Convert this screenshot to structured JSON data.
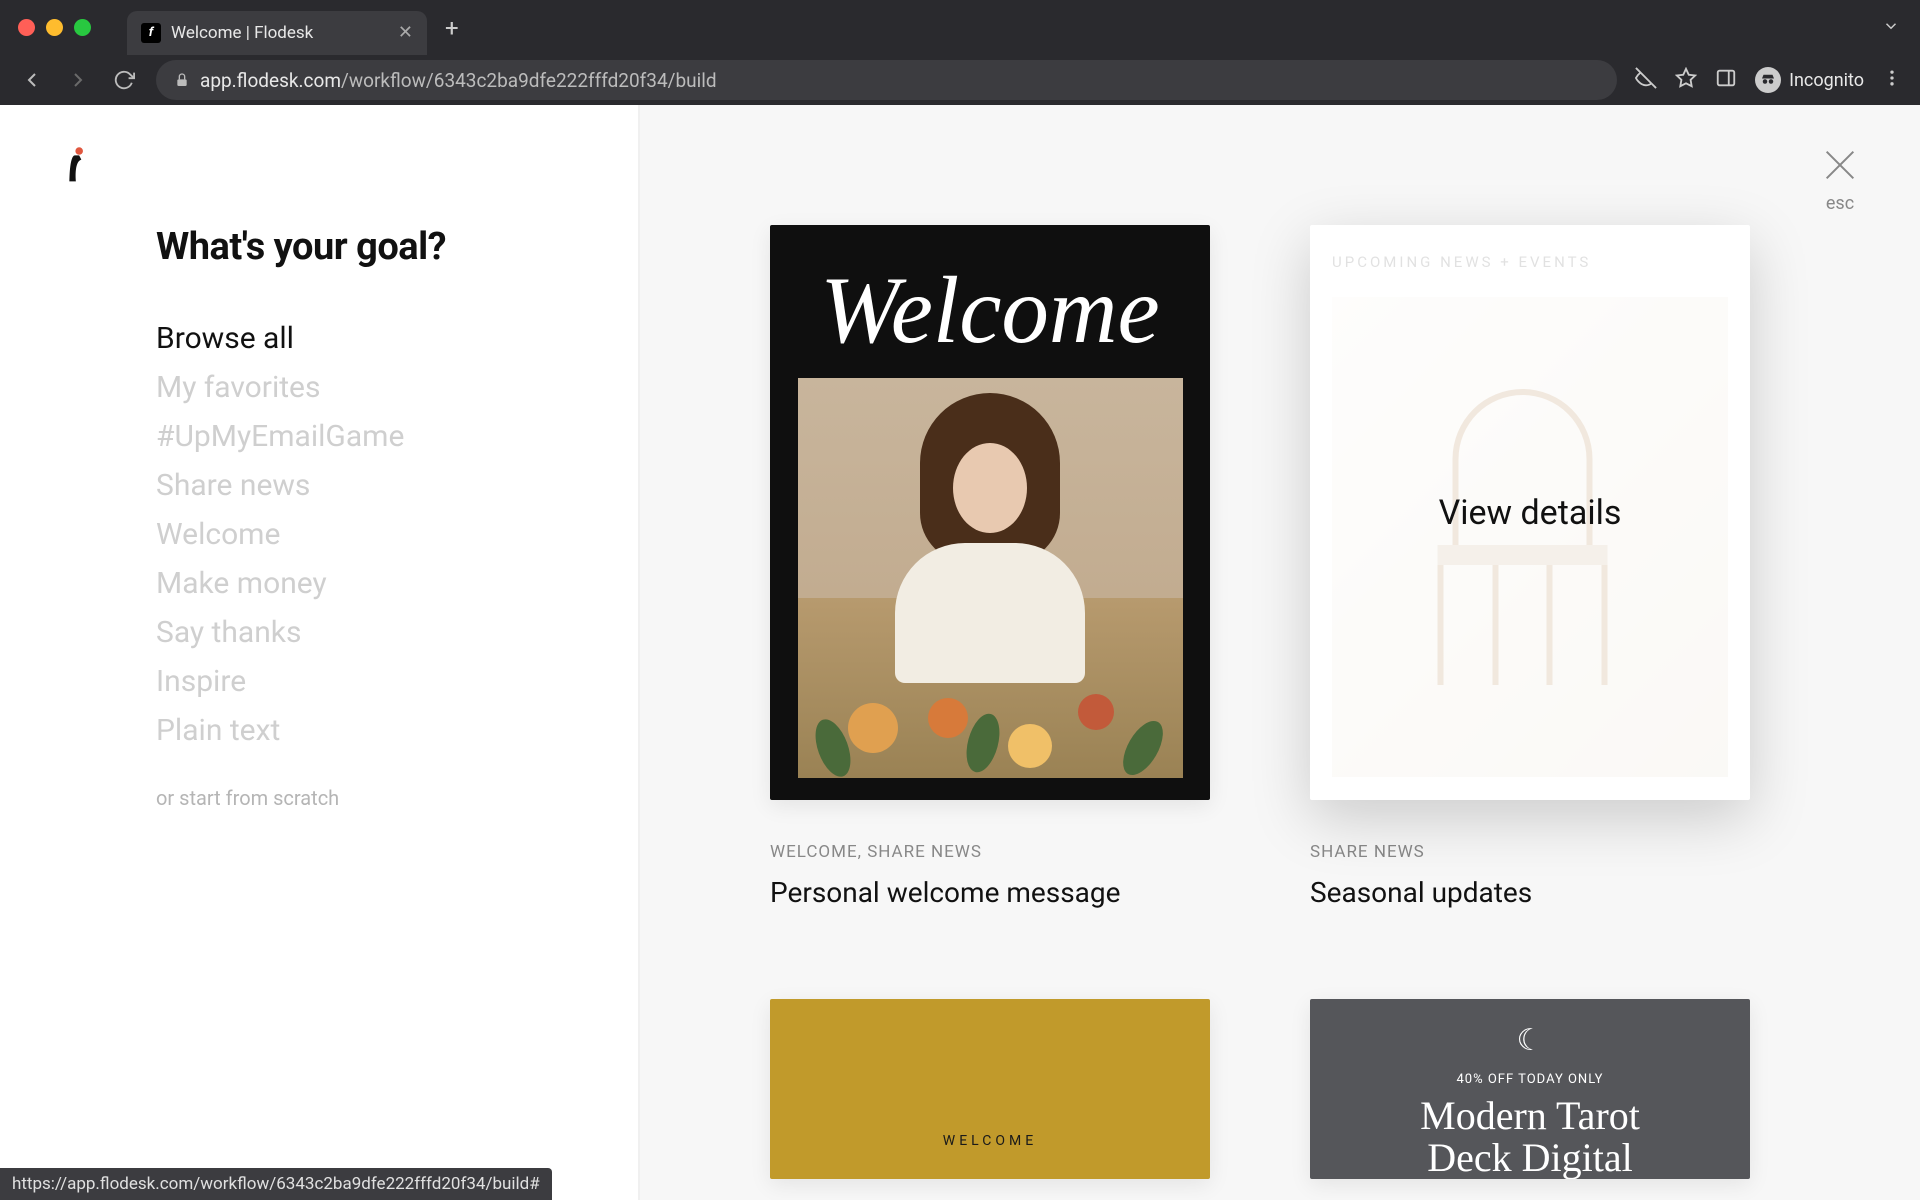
{
  "browser": {
    "tab_title": "Welcome | Flodesk",
    "url_host": "app.flodesk.com",
    "url_path": "/workflow/6343c2ba9dfe222fffd20f34/build",
    "incognito_label": "Incognito",
    "status_bar": "https://app.flodesk.com/workflow/6343c2ba9dfe222fffd20f34/build#"
  },
  "close": {
    "label": "esc"
  },
  "sidebar": {
    "title": "What's your goal?",
    "items": [
      "Browse all",
      "My favorites",
      "#UpMyEmailGame",
      "Share news",
      "Welcome",
      "Make money",
      "Say thanks",
      "Inspire",
      "Plain text"
    ],
    "scratch": "or start from scratch"
  },
  "cards": {
    "c1": {
      "script": "Welcome",
      "tags": "WELCOME, SHARE NEWS",
      "title": "Personal welcome message"
    },
    "c2": {
      "eyebrow": "UPCOMING NEWS + EVENTS",
      "overlay": "View details",
      "tags": "SHARE NEWS",
      "title": "Seasonal updates"
    },
    "c3": {
      "tiny": "WELCOME"
    },
    "c4": {
      "promo": "40% OFF TODAY ONLY",
      "title_line1": "Modern Tarot",
      "title_line2": "Deck Digital"
    }
  }
}
